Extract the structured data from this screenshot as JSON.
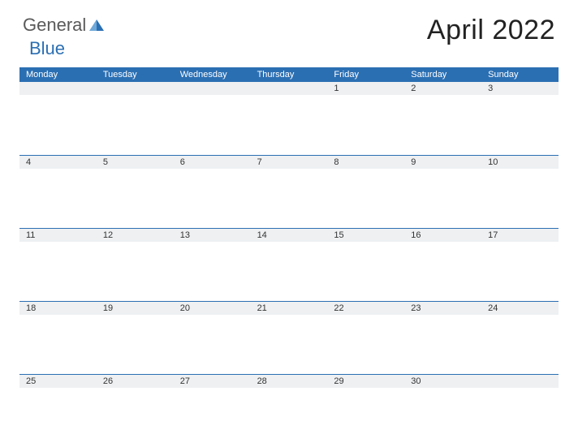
{
  "brand": {
    "word1": "General",
    "word2": "Blue"
  },
  "title": "April 2022",
  "weekdays": [
    "Monday",
    "Tuesday",
    "Wednesday",
    "Thursday",
    "Friday",
    "Saturday",
    "Sunday"
  ],
  "weeks": [
    [
      "",
      "",
      "",
      "",
      "1",
      "2",
      "3"
    ],
    [
      "4",
      "5",
      "6",
      "7",
      "8",
      "9",
      "10"
    ],
    [
      "11",
      "12",
      "13",
      "14",
      "15",
      "16",
      "17"
    ],
    [
      "18",
      "19",
      "20",
      "21",
      "22",
      "23",
      "24"
    ],
    [
      "25",
      "26",
      "27",
      "28",
      "29",
      "30",
      ""
    ]
  ]
}
